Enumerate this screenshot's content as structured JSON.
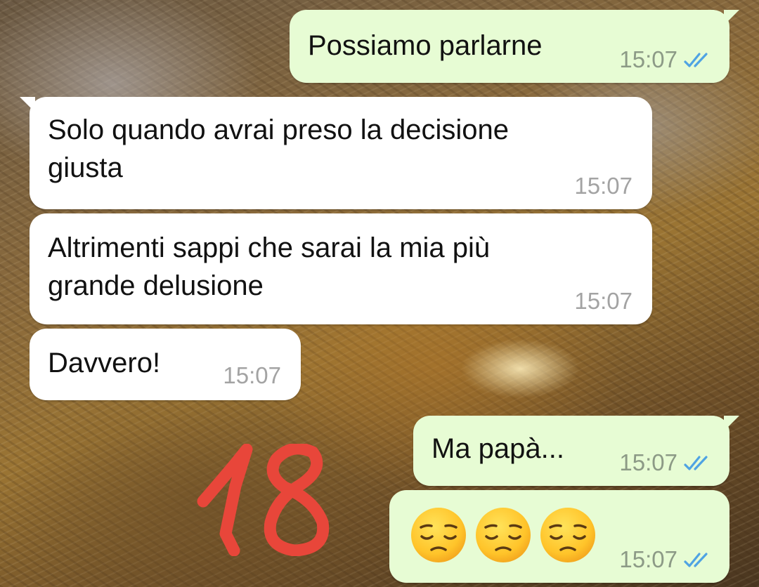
{
  "messages": [
    {
      "id": "m1",
      "direction": "outgoing",
      "text": "Possiamo parlarne",
      "time": "15:07",
      "status": "read"
    },
    {
      "id": "m2",
      "direction": "incoming",
      "text": "Solo quando avrai preso la decisione\ngiusta",
      "time": "15:07"
    },
    {
      "id": "m3",
      "direction": "incoming",
      "text": "Altrimenti sappi che sarai la mia più\ngrande delusione",
      "time": "15:07"
    },
    {
      "id": "m4",
      "direction": "incoming",
      "text": "Davvero!",
      "time": "15:07"
    },
    {
      "id": "m5",
      "direction": "outgoing",
      "text": "Ma papà...",
      "time": "15:07",
      "status": "read"
    },
    {
      "id": "m6",
      "direction": "outgoing",
      "emoji": [
        "pensive-face",
        "pensive-face",
        "pensive-face"
      ],
      "time": "15:07",
      "status": "read"
    }
  ],
  "annotation": {
    "text": "18",
    "color": "#e8463a"
  },
  "colors": {
    "outgoing_bubble": "#e7fcd4",
    "incoming_bubble": "#ffffff",
    "read_ticks": "#4fa3e3"
  }
}
